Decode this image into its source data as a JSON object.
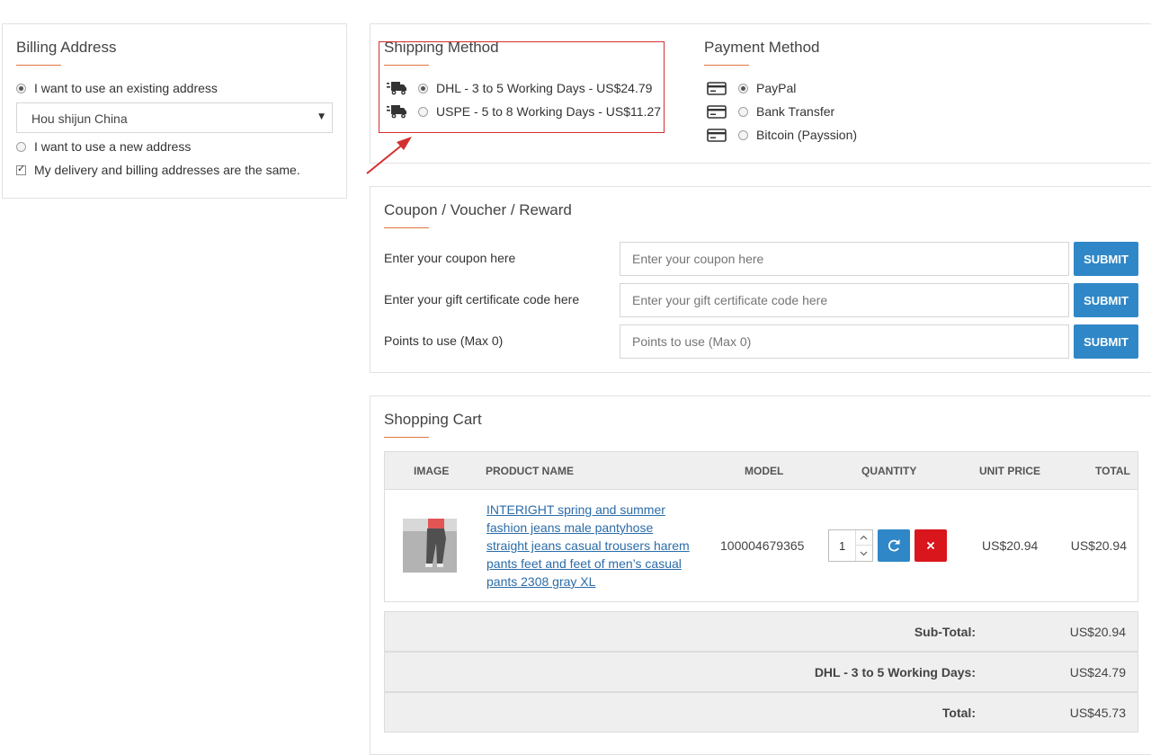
{
  "billing": {
    "title": "Billing Address",
    "existing_label": "I want to use an existing address",
    "existing_selected": true,
    "address_value": "Hou shijun China",
    "new_label": "I want to use a new address",
    "same_label": "My delivery and billing addresses are the same.",
    "same_checked": true
  },
  "shipping": {
    "title": "Shipping Method",
    "options": [
      {
        "label": "DHL - 3 to 5 Working Days - US$24.79",
        "selected": true,
        "icon": "truck-icon"
      },
      {
        "label": "USPE - 5 to 8 Working Days - US$11.27",
        "selected": false,
        "icon": "truck-icon"
      }
    ]
  },
  "payment": {
    "title": "Payment Method",
    "options": [
      {
        "label": "PayPal",
        "selected": true,
        "icon": "credit-card-icon"
      },
      {
        "label": "Bank Transfer",
        "selected": false,
        "icon": "credit-card-icon"
      },
      {
        "label": "Bitcoin (Payssion)",
        "selected": false,
        "icon": "credit-card-icon"
      }
    ]
  },
  "coupon": {
    "title": "Coupon / Voucher / Reward",
    "rows": [
      {
        "label": "Enter your coupon here",
        "placeholder": "Enter your coupon here",
        "button": "SUBMIT"
      },
      {
        "label": "Enter your gift certificate code here",
        "placeholder": "Enter your gift certificate code here",
        "button": "SUBMIT"
      },
      {
        "label": "Points to use (Max 0)",
        "placeholder": "Points to use (Max 0)",
        "button": "SUBMIT"
      }
    ]
  },
  "cart": {
    "title": "Shopping Cart",
    "headers": {
      "image": "IMAGE",
      "name": "PRODUCT NAME",
      "model": "MODEL",
      "quantity": "QUANTITY",
      "unit_price": "UNIT PRICE",
      "total": "TOTAL"
    },
    "item": {
      "name_lines": [
        "INTERIGHT spring and summer",
        "fashion jeans male pantyhose",
        "straight jeans casual trousers harem",
        "pants feet and feet of men’s casual",
        "pants 2308 gray XL"
      ],
      "model": "100004679365",
      "quantity": "1",
      "unit_price": "US$20.94",
      "total": "US$20.94"
    },
    "totals": [
      {
        "label": "Sub-Total:",
        "value": "US$20.94"
      },
      {
        "label": "DHL - 3 to 5 Working Days:",
        "value": "US$24.79"
      },
      {
        "label": "Total:",
        "value": "US$45.73"
      }
    ]
  },
  "colors": {
    "accent": "#e0763f",
    "button_blue": "#2f87c7",
    "remove_red": "#d9161c",
    "annotation_red": "#d32f2f"
  }
}
